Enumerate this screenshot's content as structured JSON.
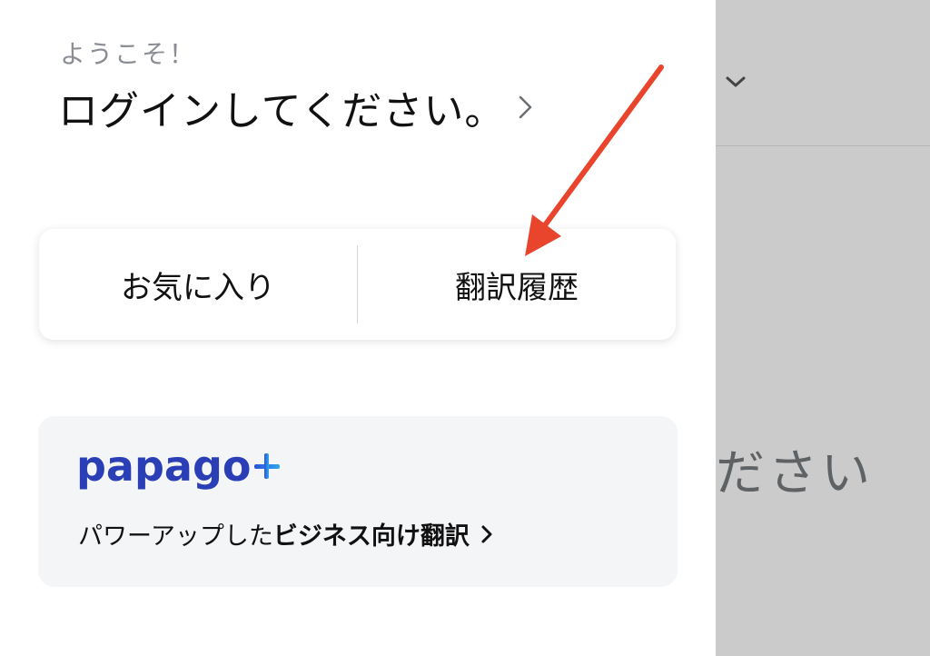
{
  "drawer": {
    "welcome": "ようこそ！",
    "login_prompt": "ログインしてください。",
    "tabs": {
      "favorites": "お気に入り",
      "history": "翻訳履歴"
    },
    "promo": {
      "logo_text": "papago",
      "line_normal": "パワーアップした",
      "line_bold": "ビジネス向け翻訳"
    }
  },
  "background_page": {
    "partial_text": "ださい"
  },
  "annotation": {
    "arrow_color": "#e8452c"
  },
  "colors": {
    "brand_blue": "#2a3fb6",
    "promo_bg": "#f4f5f7",
    "overlay_bg": "#cbcbcb"
  }
}
